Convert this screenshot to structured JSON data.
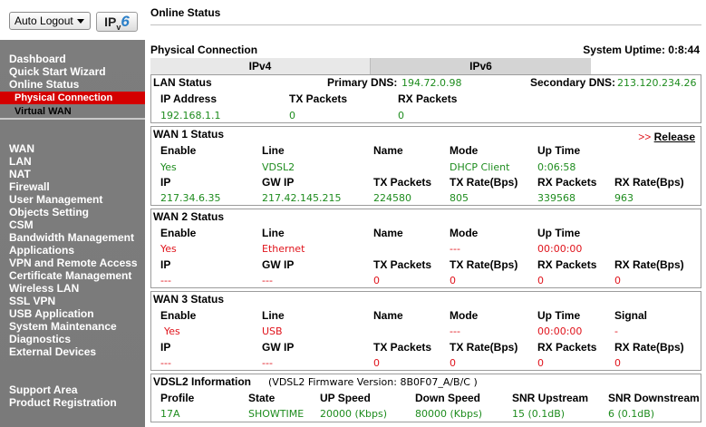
{
  "sidebar": {
    "logout_select": "Auto Logout",
    "ipv6_logo": {
      "prefix": "IP",
      "v": "v",
      "six": "6"
    },
    "top_items": [
      "Dashboard",
      "Quick Start Wizard",
      "Online Status"
    ],
    "sub_items": [
      "Physical Connection",
      "Virtual WAN"
    ],
    "main_items": [
      "WAN",
      "LAN",
      "NAT",
      "Firewall",
      "User Management",
      "Objects Setting",
      "CSM",
      "Bandwidth Management",
      "Applications",
      "VPN and Remote Access",
      "Certificate Management",
      "Wireless LAN",
      "SSL VPN",
      "USB Application",
      "System Maintenance",
      "Diagnostics",
      "External Devices"
    ],
    "bottom_items": [
      "Support Area",
      "Product Registration"
    ]
  },
  "page": {
    "title": "Online Status",
    "section": "Physical Connection",
    "uptime": "System Uptime: 0:8:44",
    "tabs": [
      "IPv4",
      "IPv6"
    ]
  },
  "lan": {
    "title": "LAN Status",
    "primary_dns_label": "Primary DNS:",
    "primary_dns": "194.72.0.98",
    "secondary_dns_label": "Secondary DNS:",
    "secondary_dns": "213.120.234.26",
    "headers": [
      "IP Address",
      "TX Packets",
      "RX Packets"
    ],
    "values": [
      "192.168.1.1",
      "0",
      "0"
    ]
  },
  "wan1": {
    "title": "WAN 1 Status",
    "release_arrows": ">>",
    "release": "Release",
    "row1_headers": [
      "Enable",
      "Line",
      "Name",
      "Mode",
      "Up Time"
    ],
    "row1_values": [
      "Yes",
      "VDSL2",
      "",
      "DHCP Client",
      "0:06:58"
    ],
    "row2_headers": [
      "IP",
      "GW IP",
      "TX Packets",
      "TX Rate(Bps)",
      "RX Packets",
      "RX Rate(Bps)"
    ],
    "row2_values": [
      "217.34.6.35",
      "217.42.145.215",
      "224580",
      "805",
      "339568",
      "963"
    ]
  },
  "wan2": {
    "title": "WAN 2 Status",
    "row1_headers": [
      "Enable",
      "Line",
      "Name",
      "Mode",
      "Up Time"
    ],
    "row1_values": [
      "Yes",
      "Ethernet",
      "",
      "---",
      "00:00:00"
    ],
    "row2_headers": [
      "IP",
      "GW IP",
      "TX Packets",
      "TX Rate(Bps)",
      "RX Packets",
      "RX Rate(Bps)"
    ],
    "row2_values": [
      "---",
      "---",
      "0",
      "0",
      "0",
      "0"
    ]
  },
  "wan3": {
    "title": "WAN 3 Status",
    "row1_headers": [
      "Enable",
      "Line",
      "Name",
      "Mode",
      "Up Time",
      "Signal"
    ],
    "row1_values": [
      "Yes",
      "USB",
      "",
      "---",
      "00:00:00",
      "-"
    ],
    "row2_headers": [
      "IP",
      "GW IP",
      "TX Packets",
      "TX Rate(Bps)",
      "RX Packets",
      "RX Rate(Bps)"
    ],
    "row2_values": [
      "---",
      "---",
      "0",
      "0",
      "0",
      "0"
    ]
  },
  "vdsl": {
    "title": "VDSL2 Information",
    "firmware": "(VDSL2 Firmware Version:  8B0F07_A/B/C )",
    "headers": [
      "Profile",
      "State",
      "UP Speed",
      "Down Speed",
      "SNR Upstream",
      "SNR Downstream"
    ],
    "values": [
      "17A",
      "SHOWTIME",
      "20000 (Kbps)",
      "80000 (Kbps)",
      "15 (0.1dB)",
      "6 (0.1dB)"
    ]
  },
  "colors": {
    "ok": "#1e8c1e",
    "alert": "#e0141c",
    "active_nav": "#d40000"
  }
}
